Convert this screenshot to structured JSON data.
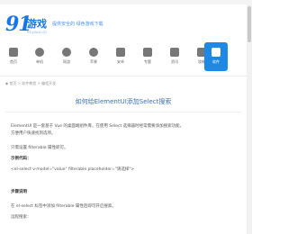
{
  "logo": {
    "mark": "91",
    "name": "游戏",
    "sub": "91youxi.cn"
  },
  "slogan": "提供安全的 绿色游戏下载",
  "nav": [
    {
      "label": "首页",
      "icon": "home-icon"
    },
    {
      "label": "单机",
      "icon": "gamepad-icon"
    },
    {
      "label": "网游",
      "icon": "globe-icon"
    },
    {
      "label": "苹果",
      "icon": "apple-icon"
    },
    {
      "label": "安卓",
      "icon": "android-icon"
    },
    {
      "label": "专题",
      "icon": "star-icon"
    },
    {
      "label": "资讯",
      "icon": "news-icon"
    },
    {
      "label": "攻略",
      "icon": "book-icon"
    },
    {
      "label": "软件",
      "icon": "app-icon",
      "active": true
    }
  ],
  "breadcrumb": "◆ 首页 > 软件教程 > 编程开发",
  "article": {
    "title": "如何给ElementUI添加Select搜索",
    "paragraphs": [
      "ElementUI 是一套基于 Vue 的桌面端组件库，在使用 Select 选择器时经常需要添加搜索功能，",
      "方便用户快速找到选项。",
      "只需设置 filterable 属性即可。",
      "示例代码：",
      "<el-select v-model=\"value\" filterable placeholder=\"请选择\">",
      "步骤说明",
      "在 el-select 标签中添加 filterable 属性后即可开启搜索。",
      "远程搜索："
    ]
  },
  "colors": {
    "brand": "#1976e8",
    "accent": "#1e88e5",
    "title": "#3b6fb5"
  }
}
